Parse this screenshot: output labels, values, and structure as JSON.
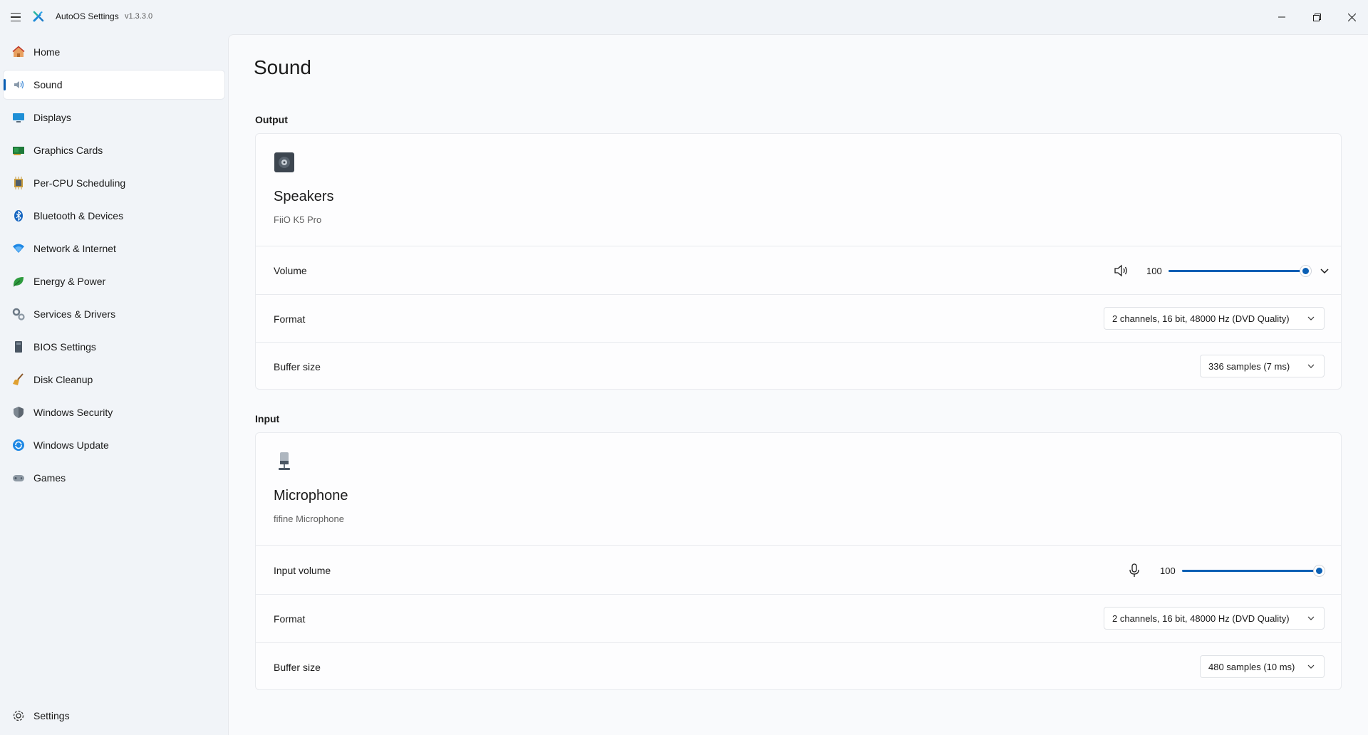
{
  "app": {
    "title": "AutoOS Settings",
    "version": "v1.3.3.0"
  },
  "sidebar": {
    "items": [
      {
        "label": "Home",
        "icon": "home-icon"
      },
      {
        "label": "Sound",
        "icon": "speaker-icon",
        "active": true
      },
      {
        "label": "Displays",
        "icon": "monitor-icon"
      },
      {
        "label": "Graphics Cards",
        "icon": "gpu-icon"
      },
      {
        "label": "Per-CPU Scheduling",
        "icon": "cpu-icon"
      },
      {
        "label": "Bluetooth & Devices",
        "icon": "bluetooth-icon"
      },
      {
        "label": "Network & Internet",
        "icon": "wifi-icon"
      },
      {
        "label": "Energy & Power",
        "icon": "leaf-icon"
      },
      {
        "label": "Services & Drivers",
        "icon": "gears-icon"
      },
      {
        "label": "BIOS Settings",
        "icon": "bios-icon"
      },
      {
        "label": "Disk Cleanup",
        "icon": "broom-icon"
      },
      {
        "label": "Windows Security",
        "icon": "shield-icon"
      },
      {
        "label": "Windows Update",
        "icon": "update-icon"
      },
      {
        "label": "Games",
        "icon": "gamepad-icon"
      }
    ],
    "settings_label": "Settings"
  },
  "page": {
    "title": "Sound",
    "output": {
      "section_label": "Output",
      "device_name": "Speakers",
      "device_sub": "FiiO K5 Pro",
      "volume_label": "Volume",
      "volume_value": "100",
      "volume_level": 1.0,
      "format_label": "Format",
      "format_value": "2 channels, 16 bit, 48000 Hz (DVD Quality)",
      "buffer_label": "Buffer size",
      "buffer_value": "336 samples (7 ms)"
    },
    "input": {
      "section_label": "Input",
      "device_name": "Microphone",
      "device_sub": "fifine Microphone",
      "volume_label": "Input volume",
      "volume_value": "100",
      "volume_level": 1.0,
      "format_label": "Format",
      "format_value": "2 channels, 16 bit, 48000 Hz (DVD Quality)",
      "buffer_label": "Buffer size",
      "buffer_value": "480 samples (10 ms)"
    }
  },
  "colors": {
    "accent": "#0a5fb4",
    "background": "#f1f4f8",
    "card": "#fdfdfe"
  }
}
